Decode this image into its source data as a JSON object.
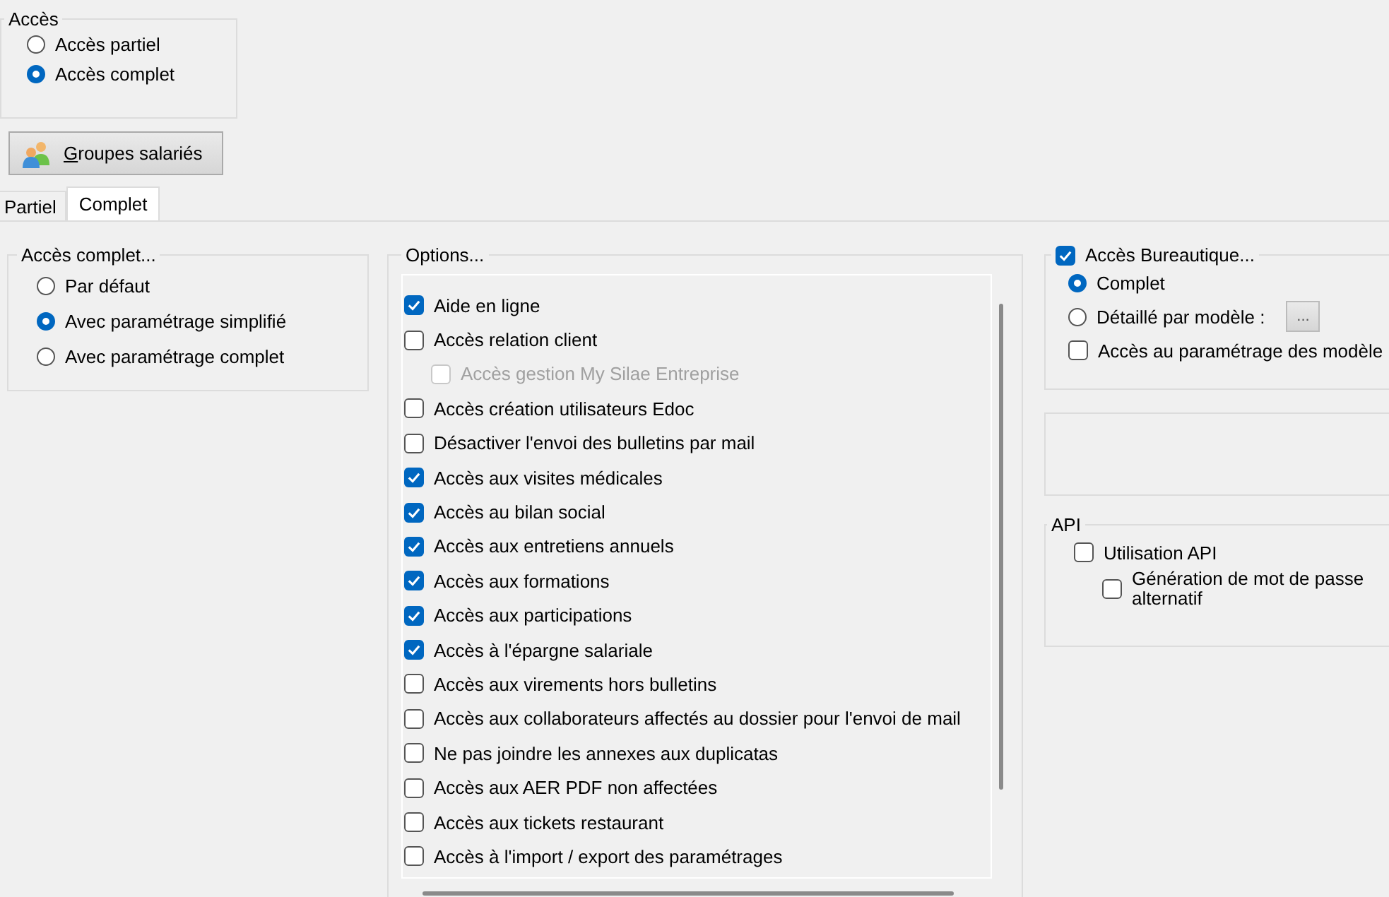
{
  "access": {
    "title": "Accès",
    "options": [
      {
        "label": "Accès partiel",
        "selected": false
      },
      {
        "label": "Accès complet",
        "selected": true
      }
    ]
  },
  "groups_button": {
    "label": "Groupes salariés"
  },
  "tabs": [
    {
      "label": "Partiel",
      "selected": false
    },
    {
      "label": "Complet",
      "selected": true
    }
  ],
  "full_access": {
    "title": "Accès complet...",
    "options": [
      {
        "label": "Par défaut",
        "selected": false
      },
      {
        "label": "Avec paramétrage simplifié",
        "selected": true
      },
      {
        "label": "Avec paramétrage complet",
        "selected": false
      }
    ]
  },
  "options": {
    "title": "Options...",
    "items": [
      {
        "label": "Aide en ligne",
        "checked": true,
        "disabled": false
      },
      {
        "label": "Accès relation client",
        "checked": false,
        "disabled": false,
        "children": [
          {
            "label": "Accès gestion My Silae Entreprise",
            "checked": false,
            "disabled": true
          }
        ]
      },
      {
        "label": "Accès création utilisateurs Edoc",
        "checked": false,
        "disabled": false
      },
      {
        "label": "Désactiver l'envoi des bulletins par mail",
        "checked": false,
        "disabled": false
      },
      {
        "label": "Accès aux visites médicales",
        "checked": true,
        "disabled": false
      },
      {
        "label": "Accès au bilan social",
        "checked": true,
        "disabled": false
      },
      {
        "label": "Accès aux entretiens annuels",
        "checked": true,
        "disabled": false
      },
      {
        "label": "Accès aux formations",
        "checked": true,
        "disabled": false
      },
      {
        "label": "Accès aux participations",
        "checked": true,
        "disabled": false
      },
      {
        "label": "Accès à l'épargne salariale",
        "checked": true,
        "disabled": false
      },
      {
        "label": "Accès aux virements hors bulletins",
        "checked": false,
        "disabled": false
      },
      {
        "label": "Accès aux collaborateurs affectés au dossier pour l'envoi de mail",
        "checked": false,
        "disabled": false
      },
      {
        "label": "Ne pas joindre les annexes aux duplicatas",
        "checked": false,
        "disabled": false
      },
      {
        "label": "Accès aux AER PDF non affectées",
        "checked": false,
        "disabled": false
      },
      {
        "label": "Accès aux tickets restaurant",
        "checked": false,
        "disabled": false
      },
      {
        "label": "Accès à l'import / export des paramétrages",
        "checked": false,
        "disabled": false
      }
    ]
  },
  "office": {
    "title": "Accès Bureautique...",
    "checked": true,
    "options": [
      {
        "label": "Complet",
        "selected": true
      },
      {
        "label": "Détaillé par modèle :",
        "selected": false
      }
    ],
    "details_button": "...",
    "settings": {
      "label": "Accès au paramétrage des modèle",
      "checked": false
    }
  },
  "api": {
    "title": "API",
    "items": [
      {
        "label": "Utilisation API",
        "checked": false,
        "children": [
          {
            "label": "Génération de mot de passe alternatif",
            "checked": false
          }
        ]
      }
    ]
  }
}
